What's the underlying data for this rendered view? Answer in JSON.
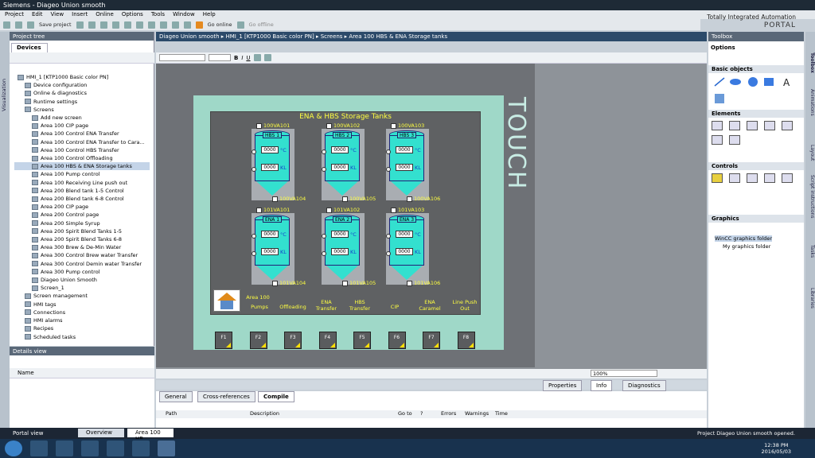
{
  "window": {
    "title": "Siemens - Diageo Union smooth"
  },
  "menu": [
    "Project",
    "Edit",
    "View",
    "Insert",
    "Online",
    "Options",
    "Tools",
    "Window",
    "Help"
  ],
  "toolbar": {
    "save": "Save project",
    "go_online": "Go online",
    "go_offline": "Go offline"
  },
  "brand": {
    "line1": "Totally Integrated Automation",
    "line2": "PORTAL"
  },
  "left": {
    "side_tab": "Visualization",
    "panel_title": "Project tree",
    "devices_tab": "Devices",
    "tree": [
      "HMI_1 [KTP1000 Basic color PN]",
      "Device configuration",
      "Online & diagnostics",
      "Runtime settings",
      "Screens",
      "Add new screen",
      "Area 100 CIP page",
      "Area 100 Control ENA Transfer",
      "Area 100 Control ENA Transfer to Cara...",
      "Area 100 Control HBS Transfer",
      "Area 100 Control Offloading",
      "Area 100 HBS & ENA Storage tanks",
      "Area 100 Pump control",
      "Area 100 Receiving Line push out",
      "Area 200 Blend tank 1-5 Control",
      "Area 200 Blend tank 6-8 Control",
      "Area 200 CIP page",
      "Area 200 Control page",
      "Area 200 Simple Syrup",
      "Area 200 Spirit Blend Tanks 1-5",
      "Area 200 Spirit Blend Tanks 6-8",
      "Area 300 Brew & De-Min Water",
      "Area 300 Control Brew water Transfer",
      "Area 300 Control Demin water Transfer",
      "Area 300 Pump control",
      "Diageo Union Smooth",
      "Screen_1",
      "Screen management",
      "HMI tags",
      "Connections",
      "HMI alarms",
      "Recipes",
      "Scheduled tasks"
    ],
    "details_title": "Details view",
    "details_col": "Name"
  },
  "editor": {
    "breadcrumb": "Diageo Union smooth ▸ HMI_1 [KTP1000 Basic color PN] ▸ Screens ▸ Area 100 HBS & ENA Storage tanks",
    "zoom": "100%"
  },
  "hmi": {
    "title": "ENA & HBS Storage Tanks",
    "touch": "TOUCH",
    "tanks_top": [
      {
        "name": "HBS 1",
        "valve_in": "100VA101",
        "valve_out": "100VA104"
      },
      {
        "name": "HBS 2",
        "valve_in": "100VA102",
        "valve_out": "100VA105"
      },
      {
        "name": "HBS 3",
        "valve_in": "100VA103",
        "valve_out": "100VA106"
      }
    ],
    "tanks_bottom": [
      {
        "name": "ENA 1",
        "valve_in": "101VA101",
        "valve_out": "101VA104"
      },
      {
        "name": "ENA 2",
        "valve_in": "101VA102",
        "valve_out": "101VA105"
      },
      {
        "name": "ENA 3",
        "valve_in": "101VA103",
        "valve_out": "101VA106"
      }
    ],
    "value_display": "0000",
    "unit_temp": "°C",
    "unit_vol": "KL",
    "nav": [
      "Area 100",
      "Pumps",
      "Offloading",
      "ENA Transfer",
      "HBS Transfer",
      "CIP",
      "ENA Caramel",
      "Line Push Out"
    ],
    "fkeys": [
      "F1",
      "F2",
      "F3",
      "F4",
      "F5",
      "F6",
      "F7",
      "F8"
    ]
  },
  "inspector": {
    "tabs_right": [
      "Properties",
      "Info",
      "Diagnostics"
    ],
    "tabs_left": [
      "General",
      "Cross-references",
      "Compile"
    ],
    "columns": [
      "Path",
      "Description",
      "Go to",
      "?",
      "Errors",
      "Warnings",
      "Time"
    ]
  },
  "toolbox": {
    "title": "Toolbox",
    "options": "Options",
    "sections": [
      "Basic objects",
      "Elements",
      "Controls",
      "Graphics"
    ],
    "graphics_items": [
      "WinCC graphics folder",
      "My graphics folder"
    ],
    "side_tabs": [
      "Toolbox",
      "Animations",
      "Layout",
      "Script instructions",
      "Tasks",
      "Libraries"
    ]
  },
  "portal": {
    "label": "Portal view",
    "tabs": [
      "Overview",
      "Area 100 HB..."
    ],
    "status": "Project Diageo Union smooth opened."
  },
  "taskbar": {
    "time": "12:38 PM",
    "date": "2016/05/03"
  }
}
